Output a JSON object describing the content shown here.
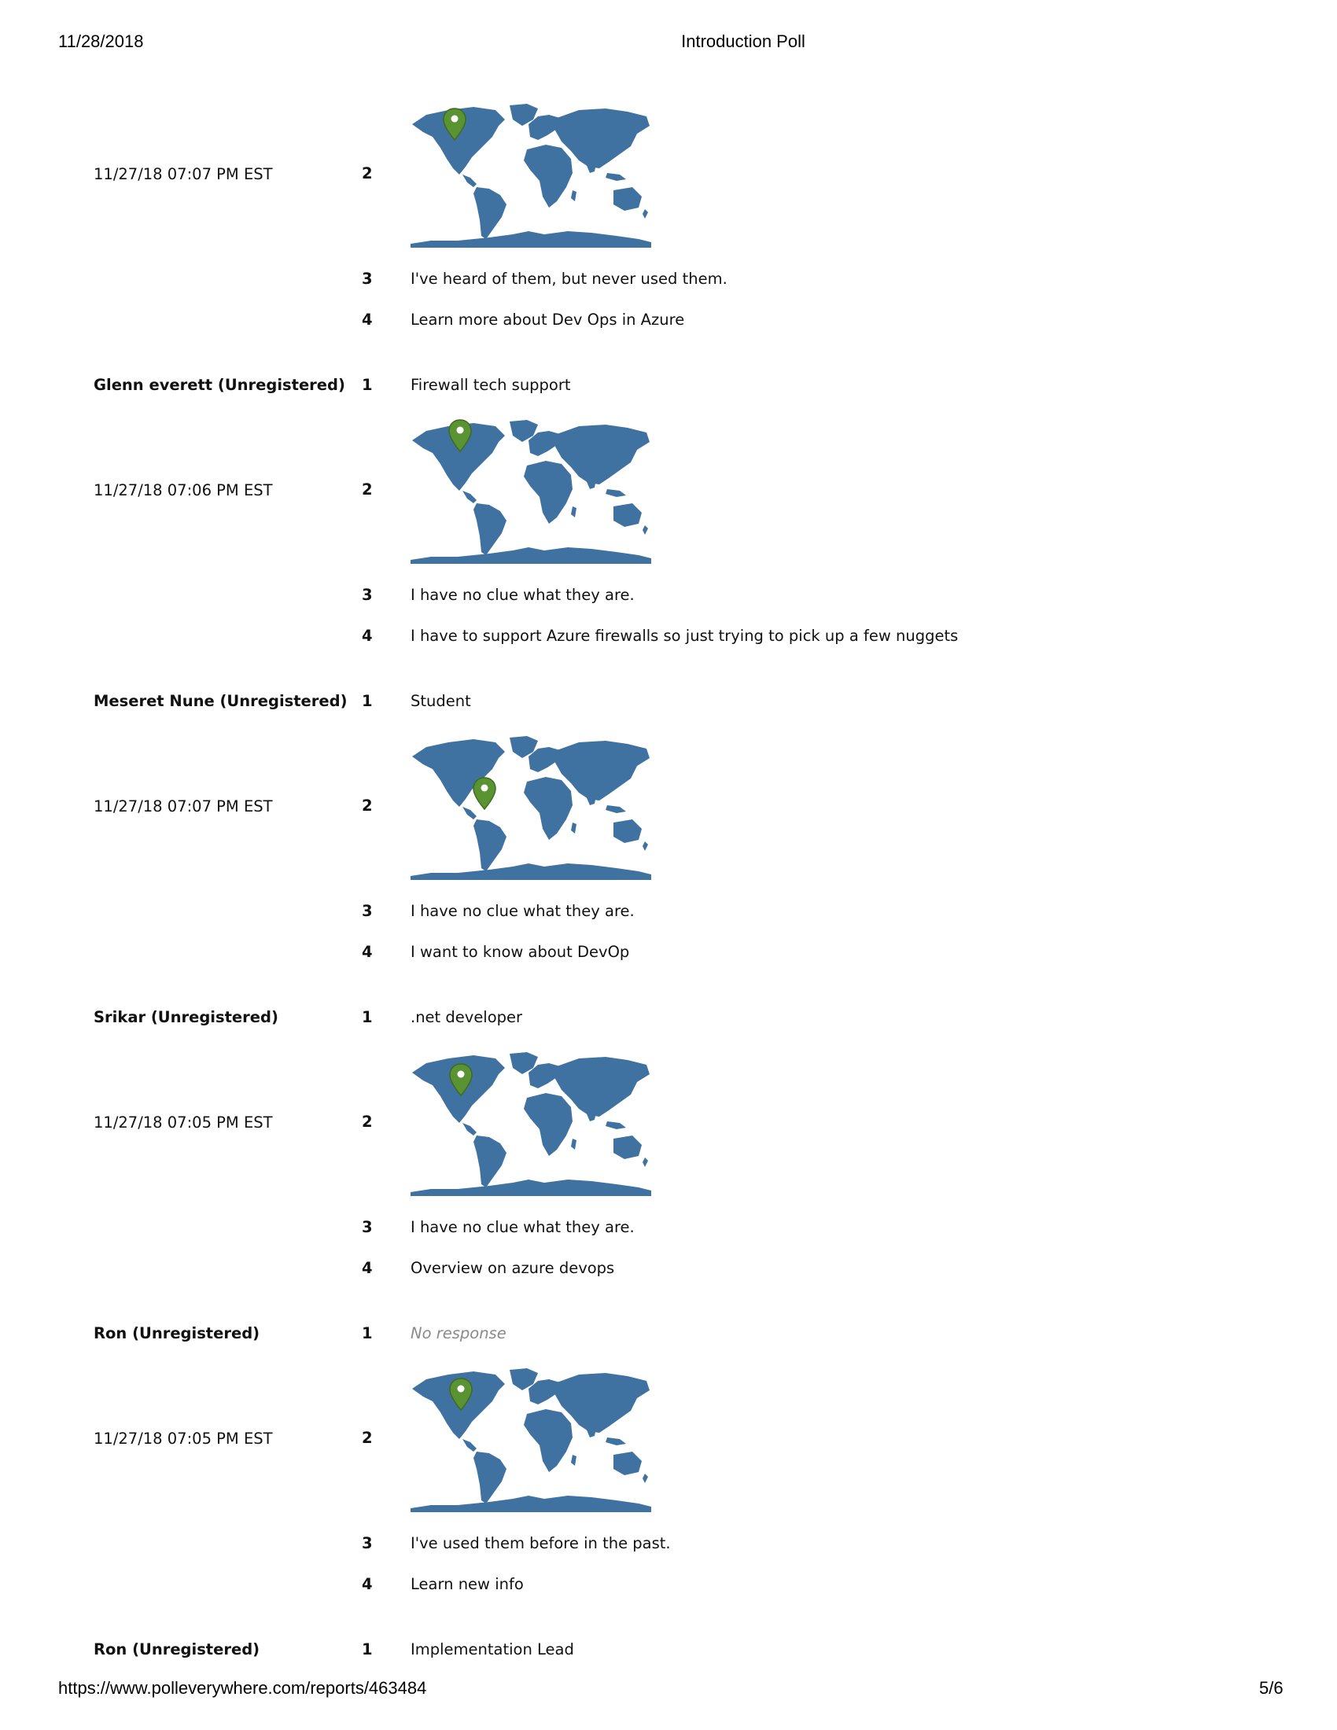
{
  "header": {
    "date": "11/28/2018",
    "title": "Introduction Poll"
  },
  "footer": {
    "url": "https://www.polleverywhere.com/reports/463484",
    "page": "5/6"
  },
  "colors": {
    "map": "#3f72a0",
    "pin": "#5a9331"
  },
  "responses": [
    {
      "timestamp": "11/27/18 07:07 PM EST",
      "q2": "2",
      "q3": "3",
      "a3": "I've heard of them, but never used them.",
      "q4": "4",
      "a4": "Learn more about Dev Ops in Azure"
    },
    {
      "name": "Glenn everett (Unregistered)",
      "timestamp": "11/27/18 07:06 PM EST",
      "q1": "1",
      "a1": "Firewall tech support",
      "q2": "2",
      "q3": "3",
      "a3": "I have no clue what they are.",
      "q4": "4",
      "a4": "I have to support Azure firewalls so just trying to pick up a few nuggets"
    },
    {
      "name": "Meseret Nune (Unregistered)",
      "timestamp": "11/27/18 07:07 PM EST",
      "q1": "1",
      "a1": "Student",
      "q2": "2",
      "q3": "3",
      "a3": "I have no clue what they are.",
      "q4": "4",
      "a4": "I want to know about DevOp"
    },
    {
      "name": "Srikar (Unregistered)",
      "timestamp": "11/27/18 07:05 PM EST",
      "q1": "1",
      "a1": ".net developer",
      "q2": "2",
      "q3": "3",
      "a3": "I have no clue what they are.",
      "q4": "4",
      "a4": "Overview on azure devops"
    },
    {
      "name": "Ron (Unregistered)",
      "timestamp": "11/27/18 07:05 PM EST",
      "q1": "1",
      "a1": "No response",
      "q2": "2",
      "q3": "3",
      "a3": "I've used them before in the past.",
      "q4": "4",
      "a4": "Learn new info"
    },
    {
      "name": "Ron (Unregistered)",
      "q1": "1",
      "a1": "Implementation Lead"
    }
  ]
}
